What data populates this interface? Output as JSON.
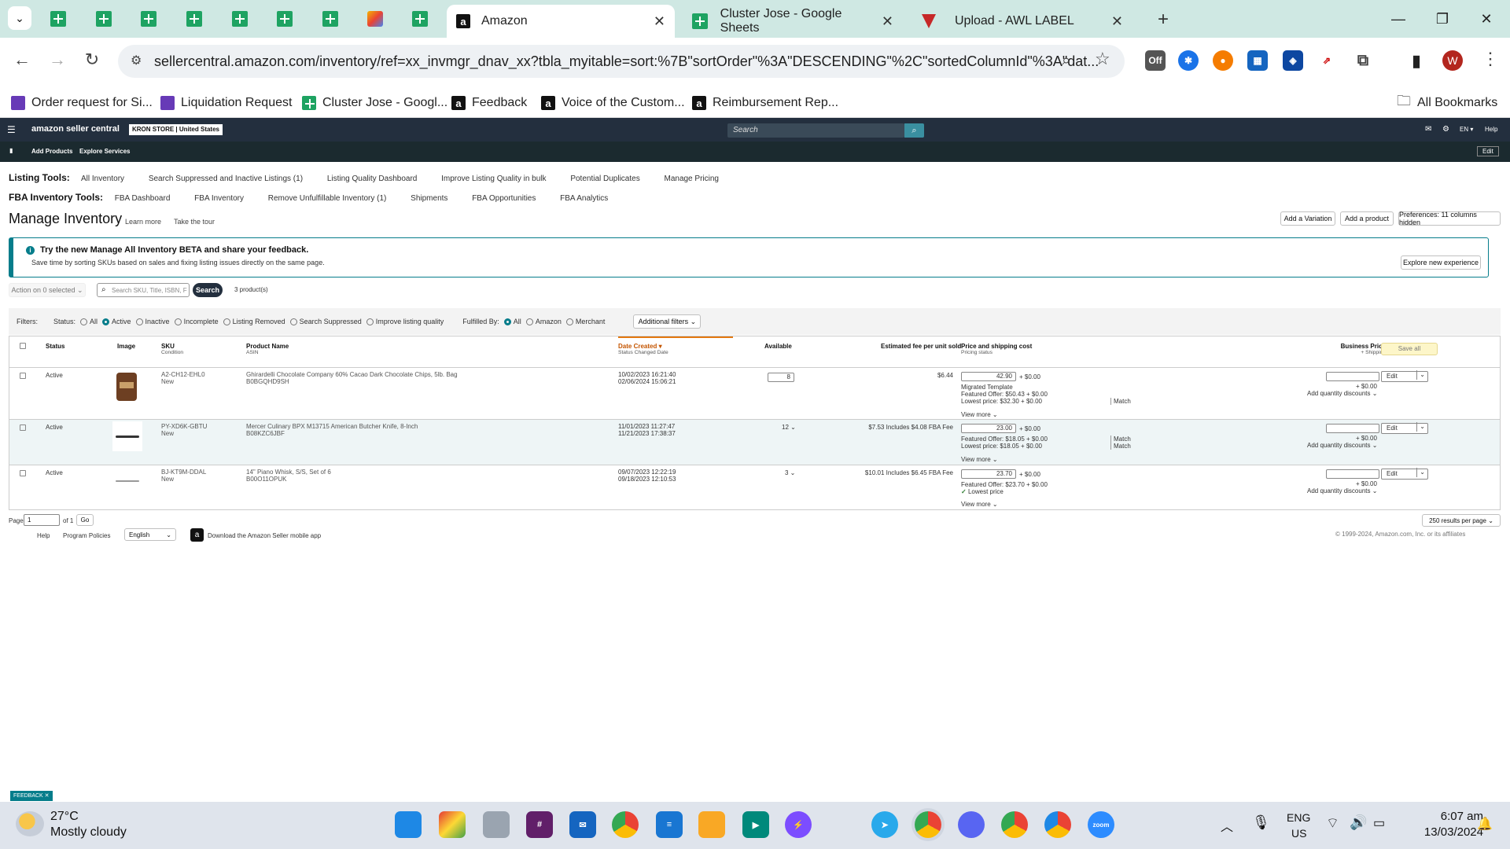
{
  "browser": {
    "tabs": [
      {
        "label": "Amazon"
      },
      {
        "label": "Cluster Jose - Google Sheets"
      },
      {
        "label": "Upload - AWL LABEL"
      }
    ],
    "url": "sellercentral.amazon.com/inventory/ref=xx_invmgr_dnav_xx?tbla_myitable=sort:%7B\"sortOrder\"%3A\"DESCENDING\"%2C\"sortedColumnId\"%3A\"dat...",
    "profile_initial": "W",
    "ext_off_label": "Off",
    "bookmarks": [
      {
        "label": "Order request for Si..."
      },
      {
        "label": "Liquidation Request"
      },
      {
        "label": "Cluster Jose - Googl..."
      },
      {
        "label": "Feedback"
      },
      {
        "label": "Voice of the Custom..."
      },
      {
        "label": "Reimbursement Rep..."
      }
    ],
    "all_bookmarks": "All Bookmarks"
  },
  "seller": {
    "logo": "amazon seller central",
    "store": "KRON STORE | United States",
    "search_placeholder": "Search",
    "lang": "EN",
    "help": "Help",
    "sub_add_products": "Add Products",
    "sub_explore": "Explore Services",
    "sub_edit": "Edit"
  },
  "listing_tools": {
    "label": "Listing Tools:",
    "items": [
      "All Inventory",
      "Search Suppressed and Inactive Listings (1)",
      "Listing Quality Dashboard",
      "Improve Listing Quality in bulk",
      "Potential Duplicates",
      "Manage Pricing"
    ]
  },
  "fba_tools": {
    "label": "FBA Inventory Tools:",
    "items": [
      "FBA Dashboard",
      "FBA Inventory",
      "Remove Unfulfillable Inventory (1)",
      "Shipments",
      "FBA Opportunities",
      "FBA Analytics"
    ]
  },
  "page": {
    "title": "Manage Inventory",
    "learn_more": "Learn more",
    "tour": "Take the tour",
    "add_variation": "Add a Variation",
    "add_product": "Add a product",
    "preferences": "Preferences: 11 columns hidden"
  },
  "banner": {
    "title": "Try the new Manage All Inventory BETA and share your feedback.",
    "text": "Save time by sorting SKUs based on sales and fixing listing issues directly on the same page.",
    "button": "Explore new experience"
  },
  "actions": {
    "action_select": "Action on 0 selected",
    "search_placeholder": "Search SKU, Title, ISBN, F",
    "search_button": "Search",
    "count": "3 product(s)"
  },
  "filters": {
    "label": "Filters:",
    "status_label": "Status:",
    "status_options": [
      "All",
      "Active",
      "Inactive",
      "Incomplete",
      "Listing Removed",
      "Search Suppressed",
      "Improve listing quality"
    ],
    "fulfilled_label": "Fulfilled By:",
    "fulfilled_options": [
      "All",
      "Amazon",
      "Merchant"
    ],
    "additional": "Additional filters"
  },
  "table": {
    "headers": {
      "status": "Status",
      "image": "Image",
      "sku": "SKU",
      "sku_sub": "Condition",
      "name": "Product Name",
      "name_sub": "ASIN",
      "date": "Date Created",
      "date_sub": "Status Changed Date",
      "available": "Available",
      "fee": "Estimated fee per unit sold",
      "price": "Price and shipping cost",
      "price_sub": "Pricing status",
      "business": "Business Price",
      "business_sub": "+ Shipping",
      "save_all": "Save all"
    },
    "rows": [
      {
        "status": "Active",
        "sku": "A2-CH12-EHL0",
        "condition": "New",
        "name": "Ghirardelli Chocolate Company 60% Cacao Dark Chocolate Chips, 5lb. Bag",
        "asin": "B0BGQHD9SH",
        "created": "10/02/2023 16:21:40",
        "changed": "02/06/2024 15:06:21",
        "available": "8",
        "fee": "$6.44",
        "price": "42.90",
        "shipping": "+ $0.00",
        "line1": "Migrated Template",
        "line2": "Featured Offer: $50.43 + $0.00",
        "line3": "Lowest price: $32.30 + $0.00",
        "match1": "Match",
        "match2": "",
        "business_ship": "+ $0.00",
        "qty_discounts": "Add quantity discounts",
        "edit": "Edit",
        "view_more": "View more"
      },
      {
        "status": "Active",
        "sku": "PY-XD6K-GBTU",
        "condition": "New",
        "name": "Mercer Culinary BPX M13715 American Butcher Knife, 8-Inch",
        "asin": "B08KZC6JBF",
        "created": "11/01/2023 11:27:47",
        "changed": "11/21/2023 17:38:37",
        "available": "12",
        "fee": "$7.53 Includes $4.08 FBA Fee",
        "price": "23.00",
        "shipping": "+ $0.00",
        "line1": "Featured Offer: $18.05 + $0.00",
        "line2": "Lowest price: $18.05 + $0.00",
        "line3": "",
        "match1": "Match",
        "match2": "Match",
        "business_ship": "+ $0.00",
        "qty_discounts": "Add quantity discounts",
        "edit": "Edit",
        "view_more": "View more"
      },
      {
        "status": "Active",
        "sku": "BJ-KT9M-DDAL",
        "condition": "New",
        "name": "14\" Piano Whisk, S/S, Set of 6",
        "asin": "B00O11OPUK",
        "created": "09/07/2023 12:22:19",
        "changed": "09/18/2023 12:10:53",
        "available": "3",
        "fee": "$10.01 Includes $6.45 FBA Fee",
        "price": "23.70",
        "shipping": "+ $0.00",
        "line1": "Featured Offer: $23.70 + $0.00",
        "line2": "Lowest price",
        "line3": "",
        "match1": "",
        "match2": "",
        "business_ship": "+ $0.00",
        "qty_discounts": "Add quantity discounts",
        "edit": "Edit",
        "view_more": "View more"
      }
    ]
  },
  "pager": {
    "label": "Page",
    "value": "1",
    "of": "of 1",
    "go": "Go",
    "per_page": "250 results per page"
  },
  "footer": {
    "help": "Help",
    "policies": "Program Policies",
    "language": "English",
    "app": "Download the Amazon Seller mobile app",
    "copyright": "© 1999-2024, Amazon.com, Inc. or its affiliates",
    "feedback": "FEEDBACK"
  },
  "taskbar": {
    "temp": "27°C",
    "weather": "Mostly cloudy",
    "lang1": "ENG",
    "lang2": "US",
    "time": "6:07 am",
    "date": "13/03/2024"
  }
}
